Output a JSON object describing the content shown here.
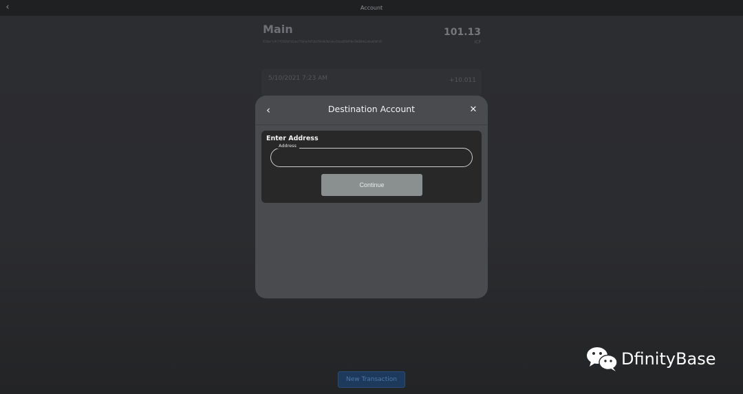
{
  "topbar": {
    "title": "Account"
  },
  "account": {
    "name": "Main",
    "id": "5530cfc9f7f15654f42ae7f3b3ef0f3b2f9e4b5b1ebc54ea0589f0e596884e2d4e850fd5",
    "balance": "101.13",
    "unit": "ICP"
  },
  "transaction": {
    "date": "5/10/2021 7:23 AM",
    "amount": "+10.011"
  },
  "new_transaction_label": "New Transaction",
  "modal": {
    "title": "Destination Account",
    "section_label": "Enter Address",
    "field_label": "Address",
    "field_value": "",
    "continue_label": "Continue"
  },
  "watermark": {
    "text": "DfinityBase"
  }
}
